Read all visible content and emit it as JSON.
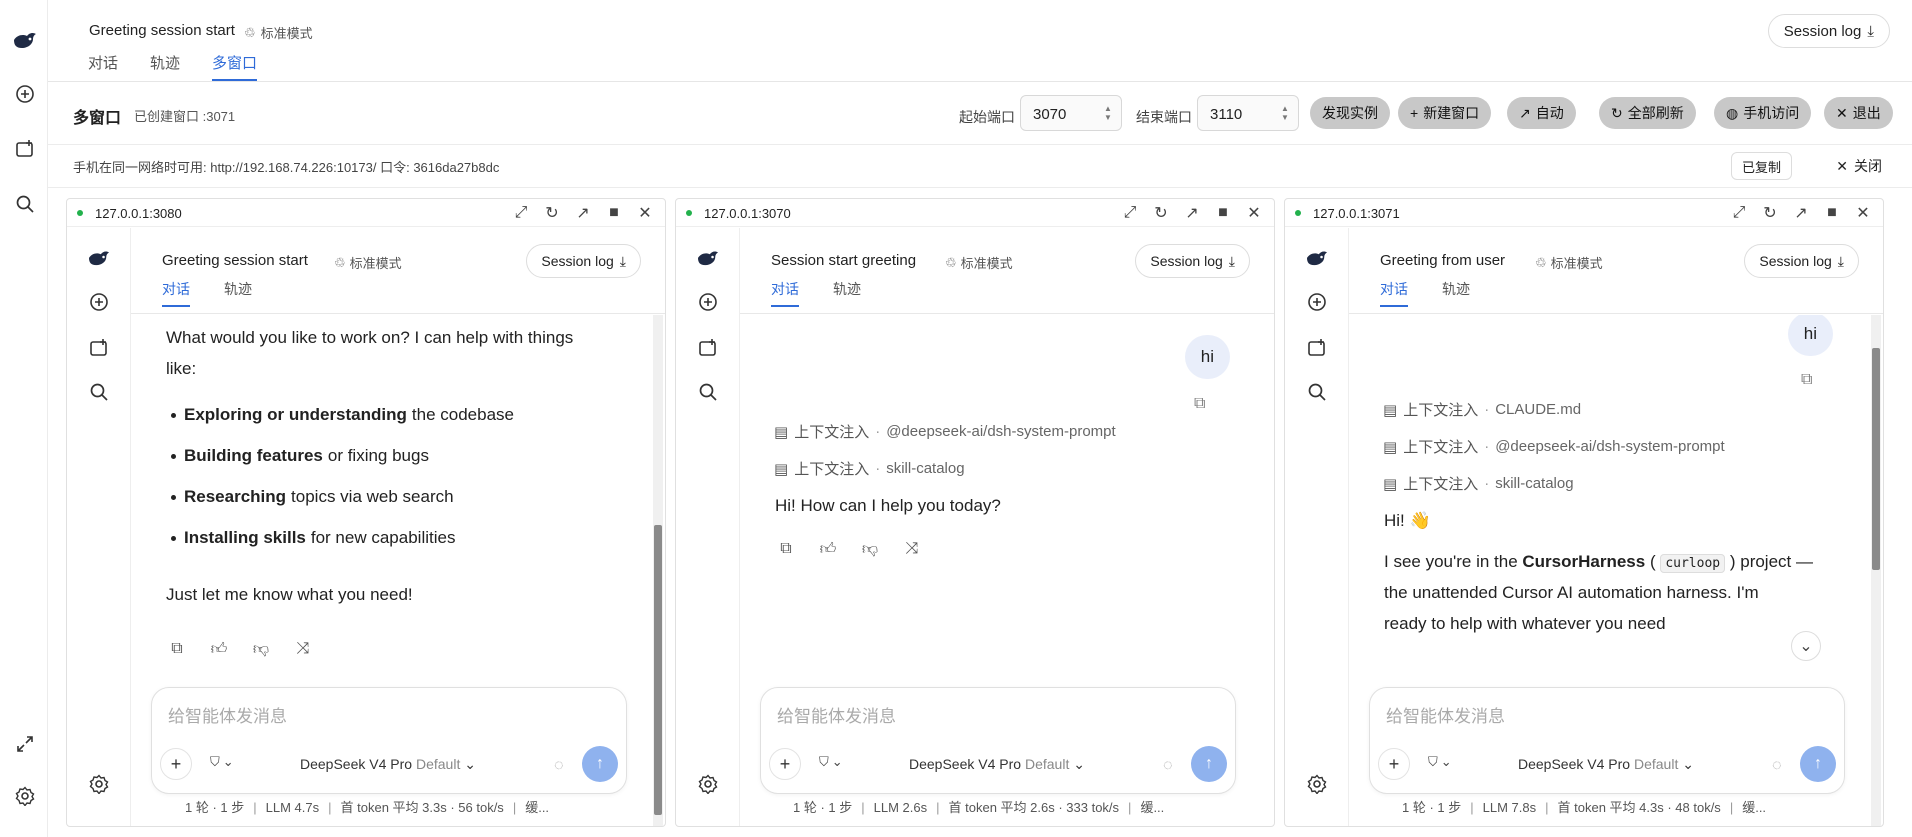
{
  "app": {
    "title": "Greeting session start",
    "mode": "标准模式",
    "tabs": [
      "对话",
      "轨迹",
      "多窗口"
    ],
    "session_log": "Session log"
  },
  "toolbar": {
    "title": "多窗口",
    "created": "已创建窗口 :3071",
    "start_port_label": "起始端口",
    "start_port": "3070",
    "end_port_label": "结束端口",
    "end_port": "3110",
    "buttons": {
      "discover": "发现实例",
      "new_window": "新建窗口",
      "auto": "自动",
      "refresh_all": "全部刷新",
      "mobile": "手机访问",
      "exit": "退出"
    }
  },
  "infobar": {
    "text": "手机在同一网络时可用: http://192.168.74.226:10173/ 口令: 3616da27b8dc",
    "copied": "已复制",
    "close": "关闭"
  },
  "common": {
    "mode": "标准模式",
    "session_log": "Session log",
    "tab_chat": "对话",
    "tab_trace": "轨迹",
    "placeholder": "给智能体发消息",
    "model_name": "DeepSeek V4 Pro",
    "model_default": "Default",
    "ctx_label": "上下文注入",
    "dot": "·"
  },
  "windows": [
    {
      "address": "127.0.0.1:3080",
      "title": "Greeting session start",
      "intro": "What would you like to work on? I can help with things",
      "intro2": "like:",
      "items": [
        {
          "bold": "Exploring or understanding",
          "rest": "the codebase"
        },
        {
          "bold": "Building features",
          "rest": "or fixing bugs"
        },
        {
          "bold": "Researching",
          "rest": "topics via web search"
        },
        {
          "bold": "Installing skills",
          "rest": "for new capabilities"
        }
      ],
      "outro": "Just let me know what you need!",
      "stats": [
        "1 轮 · 1 步",
        "LLM 4.7s",
        "首 token 平均 3.3s · 56 tok/s",
        "缓..."
      ]
    },
    {
      "address": "127.0.0.1:3070",
      "title": "Session start greeting",
      "user_msg": "hi",
      "ctx": [
        "@deepseek-ai/dsh-system-prompt",
        "skill-catalog"
      ],
      "reply": "Hi! How can I help you today?",
      "stats": [
        "1 轮 · 1 步",
        "LLM 2.6s",
        "首 token 平均 2.6s · 333 tok/s",
        "缓..."
      ]
    },
    {
      "address": "127.0.0.1:3071",
      "title": "Greeting from user",
      "user_msg": "hi",
      "ctx": [
        "CLAUDE.md",
        "@deepseek-ai/dsh-system-prompt",
        "skill-catalog"
      ],
      "reply1": "Hi! 👋",
      "reply2_a": "I see you're in the ",
      "reply2_b": "CursorHarness",
      "reply2_c": "curloop",
      "reply2_d": " project —",
      "reply3": "the unattended Cursor AI automation harness. I'm",
      "reply4": "ready to help with whatever you need",
      "stats": [
        "1 轮 · 1 步",
        "LLM 7.8s",
        "首 token 平均 4.3s · 48 tok/s",
        "缓..."
      ]
    }
  ]
}
